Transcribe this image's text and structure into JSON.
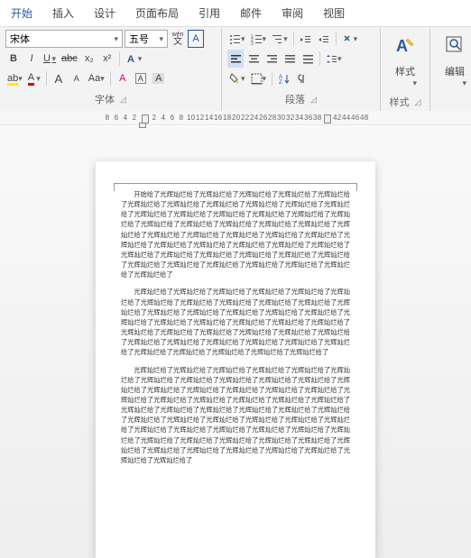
{
  "tabs": {
    "start": "开始",
    "insert": "插入",
    "design": "设计",
    "layout": "页面布局",
    "references": "引用",
    "mailings": "邮件",
    "review": "审阅",
    "view": "视图"
  },
  "font": {
    "name": "宋体",
    "size": "五号",
    "wen": "wén",
    "wenchar": "文",
    "A": "A",
    "bold": "B",
    "italic": "I",
    "underline": "U",
    "strike": "abc",
    "sub": "x₂",
    "sup": "x²",
    "aplus": "A",
    "aminus": "A",
    "aa": "Aa",
    "clear": "A",
    "hilite": "ab",
    "color": "A",
    "group_label": "字体"
  },
  "paragraph": {
    "group_label": "段落"
  },
  "styles": {
    "label": "样式",
    "group_label": "样式"
  },
  "editing": {
    "label": "编辑"
  },
  "ruler": [
    "8",
    "6",
    "4",
    "2",
    "",
    "2",
    "4",
    "6",
    "8",
    "10",
    "12",
    "14",
    "16",
    "18",
    "20",
    "22",
    "24",
    "26",
    "28",
    "30",
    "32",
    "34",
    "36",
    "38",
    "",
    "42",
    "44",
    "46",
    "48"
  ],
  "document": {
    "p1": "开始给了光辉灿烂给了光辉灿烂给了光辉灿烂给了光辉灿烂给了光辉灿烂给了光辉灿烂给了光辉灿烂给了光辉灿烂给了光辉灿烂给了光辉灿烂给了光辉灿烂给了光辉灿烂给了光辉灿烂给了光辉灿烂给了光辉灿烂给了光辉灿烂给了光辉灿烂给了光辉灿烂给了光辉灿烂给了光辉灿烂给了光辉灿烂给了光辉灿烂给了光辉灿烂给了光辉灿烂给了光辉灿烂给了光辉灿烂给了光辉灿烂给了光辉灿烂给了光辉灿烂给了光辉灿烂给了光辉灿烂给了光辉灿烂给了光辉灿烂给了光辉灿烂给了光辉灿烂给了光辉灿烂给了光辉灿烂给了光辉灿烂给了光辉灿烂给了光辉灿烂给了光辉灿烂给了光辉灿烂给了光辉灿烂给了光辉灿烂给了光辉灿烂给了光辉灿烂给了光辉灿烂给了",
    "p2": "光辉灿烂给了光辉灿烂给了光辉灿烂给了光辉灿烂给了光辉灿烂给了光辉灿烂给了光辉灿烂给了光辉灿烂给了光辉灿烂给了光辉灿烂给了光辉灿烂给了光辉灿烂给了光辉灿烂给了光辉灿烂给了光辉灿烂给了光辉灿烂给了光辉灿烂给了光辉灿烂给了光辉灿烂给了光辉灿烂给了光辉灿烂给了光辉灿烂给了光辉灿烂给了光辉灿烂给了光辉灿烂给了光辉灿烂给了光辉灿烂给了光辉灿烂给了光辉灿烂给了光辉灿烂给了光辉灿烂给了光辉灿烂给了光辉灿烂给了光辉灿烂给了光辉灿烂给了光辉灿烂给了光辉灿烂给了光辉灿烂给了光辉灿烂给了光辉灿烂给了",
    "p3": "光辉灿烂给了光辉灿烂给了光辉灿烂给了光辉灿烂给了光辉灿烂给了光辉灿烂给了光辉灿烂给了光辉灿烂给了光辉灿烂给了光辉灿烂给了光辉灿烂给了光辉灿烂给了光辉灿烂给了光辉灿烂给了光辉灿烂给了光辉灿烂给了光辉灿烂给了光辉灿烂给了光辉灿烂给了光辉灿烂给了光辉灿烂给了光辉灿烂给了光辉灿烂给了光辉灿烂给了光辉灿烂给了光辉灿烂给了光辉灿烂给了光辉灿烂给了光辉灿烂给了光辉灿烂给了光辉灿烂给了光辉灿烂给了光辉灿烂给了光辉灿烂给了光辉灿烂给了光辉灿烂给了光辉灿烂给了光辉灿烂给了光辉灿烂给了光辉灿烂给了光辉灿烂给了光辉灿烂给了光辉灿烂给了光辉灿烂给了光辉灿烂给了光辉灿烂给了光辉灿烂给了光辉灿烂给了光辉灿烂给了光辉灿烂给了光辉灿烂给了光辉灿烂给了光辉灿烂给了光辉灿烂给了"
  }
}
